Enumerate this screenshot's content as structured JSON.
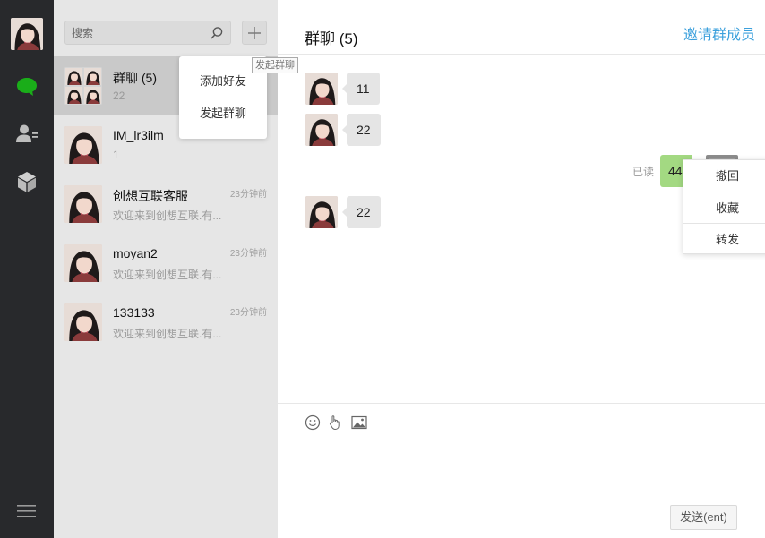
{
  "search": {
    "placeholder": "搜索"
  },
  "add_popup": {
    "items": [
      "添加好友",
      "发起群聊"
    ],
    "tooltip": "发起群聊"
  },
  "conversations": [
    {
      "name": "群聊 (5)",
      "last_message": "22",
      "time": "",
      "active": true
    },
    {
      "name": "IM_lr3ilm",
      "last_message": "1",
      "time": "",
      "active": false
    },
    {
      "name": "创想互联客服",
      "last_message": "欢迎来到创想互联.有...",
      "time": "23分钟前",
      "active": false
    },
    {
      "name": "moyan2",
      "last_message": "欢迎来到创想互联.有...",
      "time": "23分钟前",
      "active": false
    },
    {
      "name": "133133",
      "last_message": "欢迎来到创想互联.有...",
      "time": "23分钟前",
      "active": false
    }
  ],
  "chat": {
    "title": "群聊 (5)",
    "invite_label": "邀请群成员",
    "messages": [
      {
        "direction": "in",
        "text": "11"
      },
      {
        "direction": "in",
        "text": "22"
      },
      {
        "direction": "out",
        "text": "44",
        "status": "已读"
      },
      {
        "direction": "in",
        "text": "22"
      }
    ],
    "context_menu": [
      "撤回",
      "收藏",
      "转发"
    ],
    "send_label": "发送(ent)"
  },
  "icons": {
    "nav": [
      "chat-icon",
      "contacts-icon",
      "apps-cube-icon",
      "menu-icon"
    ],
    "toolbar": [
      "emoji-icon",
      "shake-hand-icon",
      "image-icon"
    ]
  },
  "colors": {
    "sidebar": "#28292c",
    "active_chat_icon": "#1aad19",
    "list_background": "#e6e6e6",
    "active_item": "#c9c9c9",
    "bubble_in": "#e5e5e5",
    "bubble_out": "#a3d982",
    "link": "#3ba0dc"
  }
}
